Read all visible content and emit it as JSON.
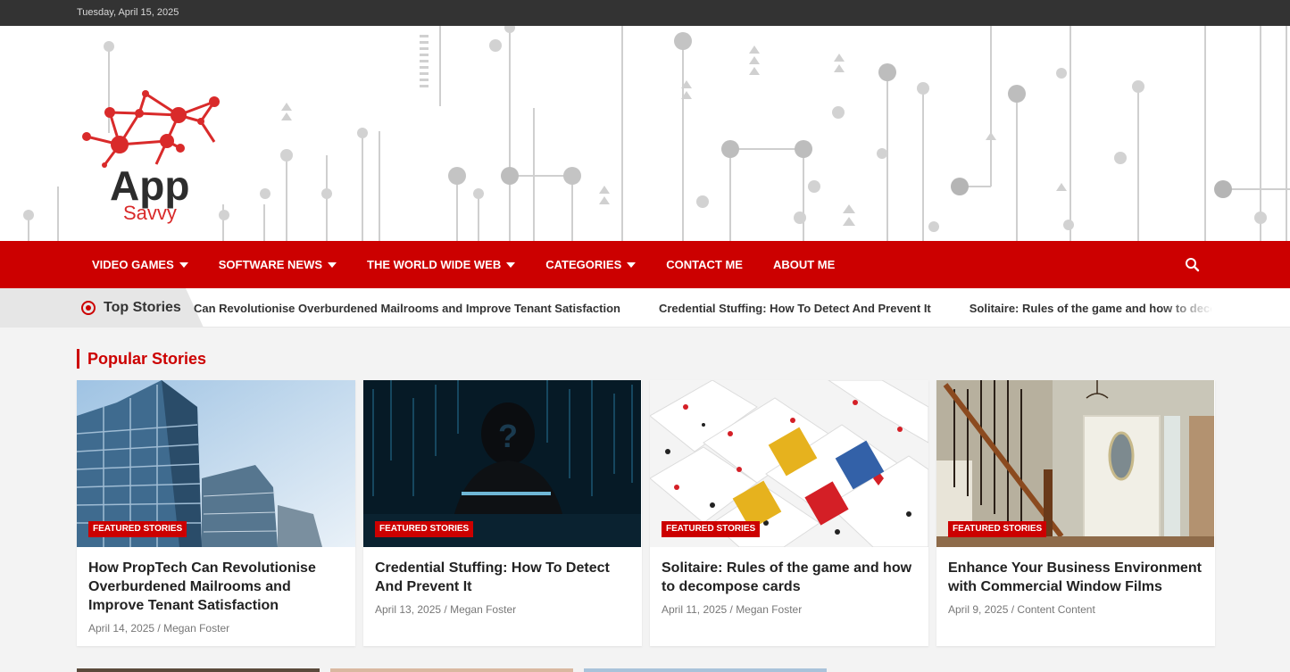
{
  "topbar": {
    "date": "Tuesday, April 15, 2025"
  },
  "logo": {
    "word1": "App",
    "word2": "Savvy"
  },
  "nav": {
    "items": [
      {
        "label": "VIDEO GAMES",
        "dropdown": true
      },
      {
        "label": "SOFTWARE NEWS",
        "dropdown": true
      },
      {
        "label": "THE WORLD WIDE WEB",
        "dropdown": true
      },
      {
        "label": "CATEGORIES",
        "dropdown": true
      },
      {
        "label": "CONTACT ME",
        "dropdown": false
      },
      {
        "label": "ABOUT ME",
        "dropdown": false
      }
    ],
    "search_icon": "search-icon"
  },
  "ticker": {
    "label": "Top Stories",
    "items": [
      "Can Revolutionise Overburdened Mailrooms and Improve Tenant Satisfaction",
      "Credential Stuffing: How To Detect And Prevent It",
      "Solitaire: Rules of the game and how to decompose cards"
    ]
  },
  "popular": {
    "heading": "Popular Stories",
    "cards": [
      {
        "badge": "FEATURED STORIES",
        "title": "How PropTech Can Revolutionise Overburdened Mailrooms and Improve Tenant Satisfaction",
        "date": "April 14, 2025",
        "author": "Megan Foster"
      },
      {
        "badge": "FEATURED STORIES",
        "title": "Credential Stuffing: How To Detect And Prevent It",
        "date": "April 13, 2025",
        "author": "Megan Foster"
      },
      {
        "badge": "FEATURED STORIES",
        "title": "Solitaire: Rules of the game and how to decompose cards",
        "date": "April 11, 2025",
        "author": "Megan Foster"
      },
      {
        "badge": "FEATURED STORIES",
        "title": "Enhance Your Business Environment with Commercial Window Films",
        "date": "April 9, 2025",
        "author": "Content Content"
      }
    ]
  },
  "colors": {
    "brand_red": "#cc0000",
    "topbar_bg": "#333333",
    "ticker_label_bg": "#e6e6e6"
  }
}
